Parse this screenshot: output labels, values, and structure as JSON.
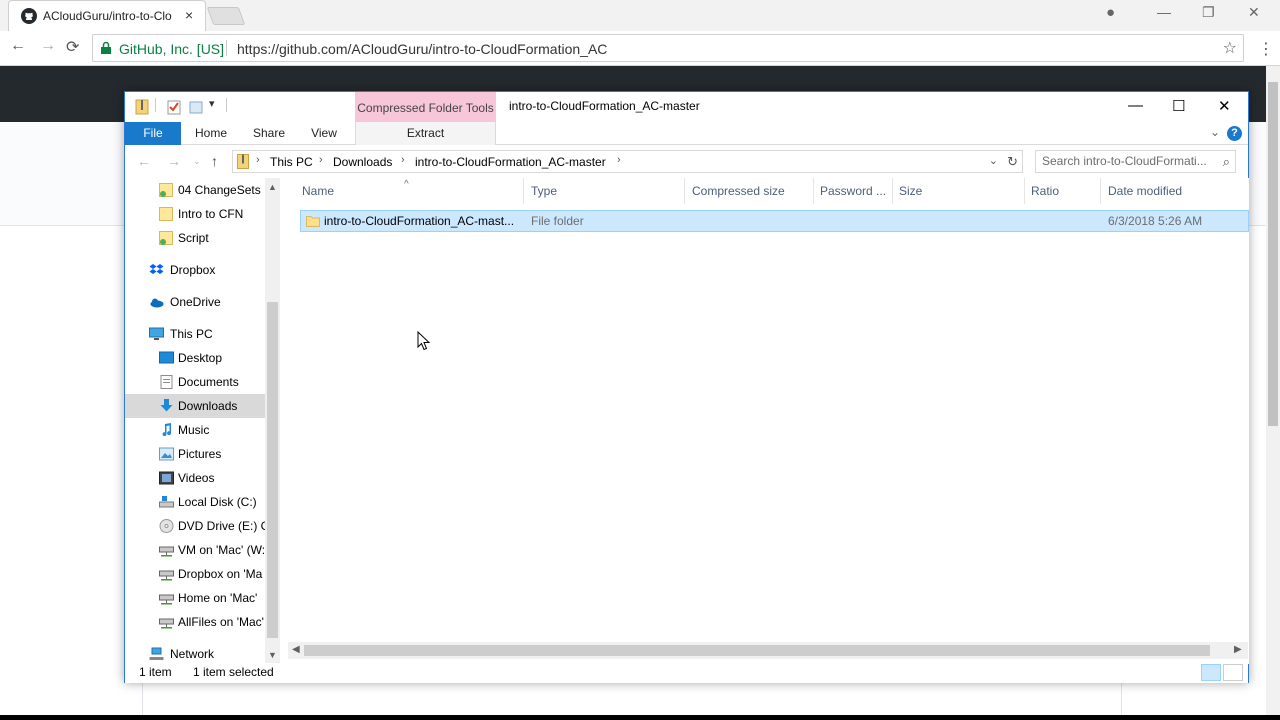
{
  "browser": {
    "tab_title": "ACloudGuru/intro-to-Clo",
    "tab_close": "×",
    "secure_label": "GitHub, Inc. [US]",
    "url": "https://github.com/ACloudGuru/intro-to-CloudFormation_AC",
    "icons": {
      "back": "←",
      "forward": "→",
      "reload": "⟳",
      "star": "☆",
      "menu": "⋮",
      "minimize": "—",
      "restore": "❐",
      "close": "✕"
    }
  },
  "explorer": {
    "window_title": "intro-to-CloudFormation_AC-master",
    "context_tab": "Compressed Folder Tools",
    "ribbon_tabs": {
      "file": "File",
      "home": "Home",
      "share": "Share",
      "view": "View",
      "extract": "Extract"
    },
    "window_controls": {
      "minimize": "—",
      "maximize": "☐",
      "close": "✕"
    },
    "help": "?",
    "breadcrumb": [
      "This PC",
      "Downloads",
      "intro-to-CloudFormation_AC-master"
    ],
    "search_placeholder": "Search intro-to-CloudFormati...",
    "nav_items": [
      {
        "label": "04 ChangeSets",
        "icon": "folder-icon"
      },
      {
        "label": "Intro to CFN",
        "icon": "folder-icon"
      },
      {
        "label": "Script",
        "icon": "folder-icon"
      },
      {
        "label": "Dropbox",
        "icon": "dropbox-icon"
      },
      {
        "label": "OneDrive",
        "icon": "onedrive-icon"
      },
      {
        "label": "This PC",
        "icon": "pc-icon"
      },
      {
        "label": "Desktop",
        "icon": "desktop-icon"
      },
      {
        "label": "Documents",
        "icon": "documents-icon"
      },
      {
        "label": "Downloads",
        "icon": "downloads-icon"
      },
      {
        "label": "Music",
        "icon": "music-icon"
      },
      {
        "label": "Pictures",
        "icon": "pictures-icon"
      },
      {
        "label": "Videos",
        "icon": "videos-icon"
      },
      {
        "label": "Local Disk (C:)",
        "icon": "disk-icon"
      },
      {
        "label": "DVD Drive (E:) CI",
        "icon": "dvd-icon"
      },
      {
        "label": "VM on 'Mac' (W:",
        "icon": "network-drive-icon"
      },
      {
        "label": "Dropbox on 'Ma",
        "icon": "network-drive-icon"
      },
      {
        "label": "Home on 'Mac'",
        "icon": "network-drive-icon"
      },
      {
        "label": "AllFiles on 'Mac'",
        "icon": "network-drive-icon"
      },
      {
        "label": "Network",
        "icon": "network-icon"
      }
    ],
    "columns": [
      "Name",
      "Type",
      "Compressed size",
      "Password ...",
      "Size",
      "Ratio",
      "Date modified"
    ],
    "rows": [
      {
        "name": "intro-to-CloudFormation_AC-mast...",
        "type": "File folder",
        "compressed_size": "",
        "password": "",
        "size": "",
        "ratio": "",
        "date_modified": "6/3/2018 5:26 AM"
      }
    ],
    "status": {
      "count": "1 item",
      "selected": "1 item selected"
    },
    "colors": {
      "accent": "#1979ca",
      "context_tab": "#f7c6d9",
      "selection": "#cce8ff"
    }
  }
}
